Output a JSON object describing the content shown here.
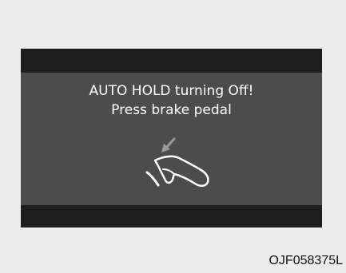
{
  "display": {
    "message_line1": "AUTO HOLD turning Off!",
    "message_line2": "Press brake pedal",
    "icon": "brake-pedal-press-icon",
    "colors": {
      "screen": "#4c4c4c",
      "bands": "#1e1e1e",
      "text": "#ffffff",
      "arrow": "#9a9a9a"
    }
  },
  "figure_code": "OJF058375L"
}
